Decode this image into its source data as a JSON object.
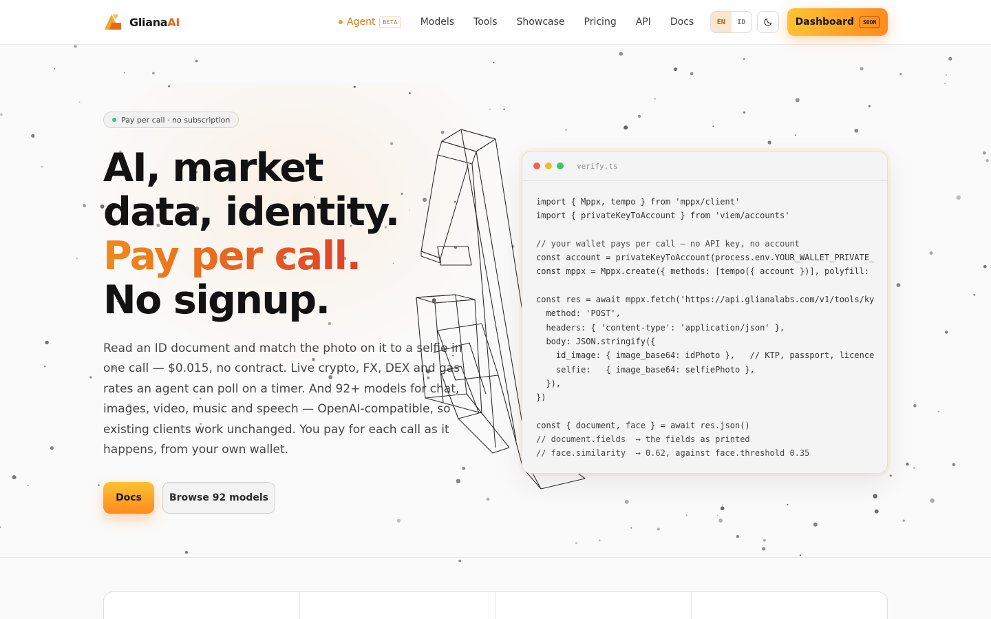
{
  "brand": {
    "name_prefix": "Gliana",
    "name_suffix": "AI",
    "accent": "#e8671c"
  },
  "nav": {
    "agent_label": "Agent",
    "agent_badge": "BETA",
    "links": [
      "Models",
      "Tools",
      "Showcase",
      "Pricing",
      "API",
      "Docs"
    ],
    "lang_options": [
      "EN",
      "ID"
    ],
    "lang_active": "EN",
    "theme_icon": "moon-icon",
    "dashboard_label": "Dashboard",
    "dashboard_badge": "SOON"
  },
  "hero": {
    "pill": "Pay per call · no subscription",
    "headline_1": "AI, market data, identity.",
    "headline_accent": "Pay per call.",
    "headline_2": "No signup.",
    "paragraph": "Read an ID document and match the photo on it to a selfie in one call — $0.015, no contract. Live crypto, FX, DEX and gas rates an agent can poll on a timer. And 92+ models for chat, images, video, music and speech — OpenAI-compatible, so existing clients work unchanged. You pay for each call as it happens, from your own wallet.",
    "btn_docs": "Docs",
    "btn_browse": "Browse 92 models"
  },
  "code": {
    "filename": "verify.ts",
    "lines": [
      "import { Mppx, tempo } from 'mppx/client'",
      "import { privateKeyToAccount } from 'viem/accounts'",
      "",
      "// your wallet pays per call — no API key, no account",
      "const account = privateKeyToAccount(process.env.YOUR_WALLET_PRIVATE_",
      "const mppx = Mppx.create({ methods: [tempo({ account })], polyfill:",
      "",
      "const res = await mppx.fetch('https://api.glianalabs.com/v1/tools/ky",
      "  method: 'POST',",
      "  headers: { 'content-type': 'application/json' },",
      "  body: JSON.stringify({",
      "    id_image: { image_base64: idPhoto },   // KTP, passport, licence",
      "    selfie:   { image_base64: selfiePhoto },",
      "  }),",
      "})",
      "",
      "const { document, face } = await res.json()",
      "// document.fields  → the fields as printed",
      "// face.similarity  → 0.62, against face.threshold 0.35"
    ]
  }
}
